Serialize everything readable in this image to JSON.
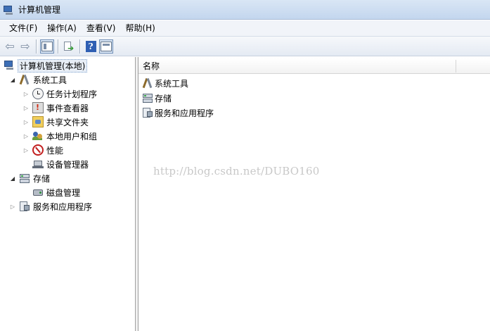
{
  "window": {
    "title": "计算机管理"
  },
  "menu": {
    "items": [
      "文件(F)",
      "操作(A)",
      "查看(V)",
      "帮助(H)"
    ]
  },
  "toolbar": {
    "buttons": [
      "back-icon",
      "forward-icon",
      "show-hide-console-tree-icon",
      "export-list-icon",
      "help-icon",
      "show-hide-action-pane-icon"
    ]
  },
  "tree": {
    "root": "计算机管理(本地)",
    "system_tools": "系统工具",
    "task_scheduler": "任务计划程序",
    "event_viewer": "事件查看器",
    "shared_folders": "共享文件夹",
    "local_users": "本地用户和组",
    "performance": "性能",
    "device_manager": "设备管理器",
    "storage": "存储",
    "disk_management": "磁盘管理",
    "services_apps": "服务和应用程序"
  },
  "list": {
    "column_name": "名称",
    "items": [
      "系统工具",
      "存储",
      "服务和应用程序"
    ]
  },
  "watermark": "http://blog.csdn.net/DUBO160"
}
